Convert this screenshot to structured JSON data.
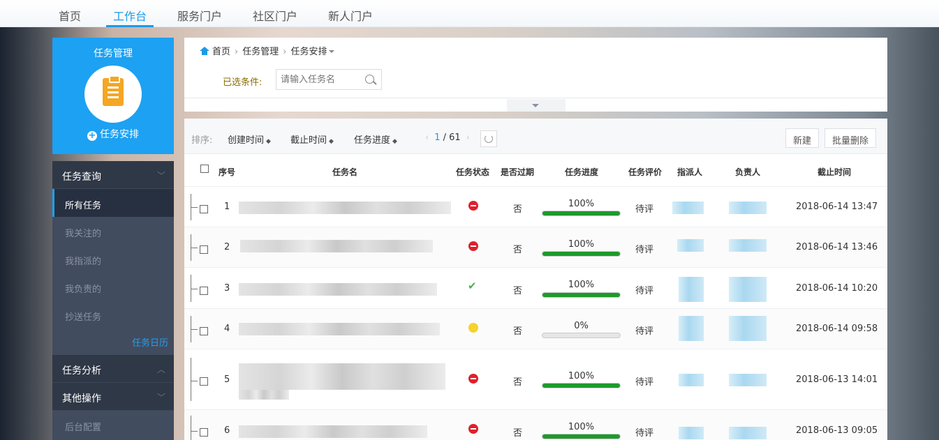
{
  "topnav": {
    "items": [
      "首页",
      "工作台",
      "服务门户",
      "社区门户",
      "新人门户"
    ],
    "active": "工作台"
  },
  "sidebar": {
    "title": "任务管理",
    "arrange_label": "任务安排",
    "groups": [
      {
        "label": "任务查询",
        "chevron": "chevron-down-icon"
      },
      {
        "label": "任务分析",
        "chevron": "chevron-up-icon"
      },
      {
        "label": "其他操作",
        "chevron": "chevron-down-icon"
      }
    ],
    "query_items": [
      "所有任务",
      "我关注的",
      "我指派的",
      "我负责的",
      "抄送任务"
    ],
    "calendar_link": "任务日历",
    "other_items": [
      "后台配置"
    ]
  },
  "breadcrumb": {
    "home": "首页",
    "level2": "任务管理",
    "level3": "任务安排"
  },
  "filter": {
    "label": "已选条件:",
    "search_placeholder": "请输入任务名"
  },
  "toolbar": {
    "sort_label": "排序:",
    "sorts": [
      "创建时间",
      "截止时间",
      "任务进度"
    ],
    "page_current": "1",
    "page_total": "/ 61",
    "new_label": "新建",
    "batch_delete_label": "批量删除"
  },
  "table": {
    "headers": [
      "序号",
      "任务名",
      "任务状态",
      "是否过期",
      "任务进度",
      "任务评价",
      "指派人",
      "负责人",
      "截止时间"
    ],
    "rows": [
      {
        "no": "1",
        "status": "red",
        "expired": "否",
        "progress": "100%",
        "progress_value": 1.0,
        "rating": "待评",
        "deadline": "2018-06-14 13:47"
      },
      {
        "no": "2",
        "status": "red",
        "expired": "否",
        "progress": "100%",
        "progress_value": 1.0,
        "rating": "待评",
        "deadline": "2018-06-14 13:46"
      },
      {
        "no": "3",
        "status": "check",
        "expired": "否",
        "progress": "100%",
        "progress_value": 1.0,
        "rating": "待评",
        "deadline": "2018-06-14 10:20"
      },
      {
        "no": "4",
        "status": "yellow",
        "expired": "否",
        "progress": "0%",
        "progress_value": 0.0,
        "rating": "待评",
        "deadline": "2018-06-14 09:58"
      },
      {
        "no": "5",
        "status": "red",
        "expired": "否",
        "progress": "100%",
        "progress_value": 1.0,
        "rating": "待评",
        "deadline": "2018-06-13 14:01"
      },
      {
        "no": "6",
        "status": "red",
        "expired": "否",
        "progress": "100%",
        "progress_value": 1.0,
        "rating": "待评",
        "deadline": "2018-06-13 09:05"
      }
    ]
  },
  "colors": {
    "accent": "#1a9be8",
    "sidebar_dark": "#2f3846",
    "progress": "#1d9a2c",
    "status_red": "#e0202c",
    "status_yellow": "#f5d22e",
    "status_green": "#4caf50"
  }
}
